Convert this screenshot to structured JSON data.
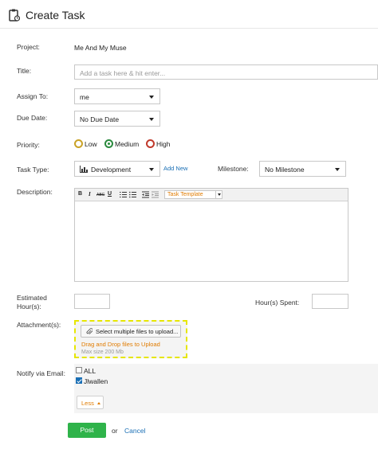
{
  "header": {
    "title": "Create Task",
    "icon": "task-clipboard-icon"
  },
  "project": {
    "label": "Project:",
    "value": "Me And My Muse"
  },
  "title_field": {
    "label": "Title:",
    "placeholder": "Add a task here & hit enter..."
  },
  "assign_to": {
    "label": "Assign To:",
    "value": "me"
  },
  "due_date": {
    "label": "Due Date:",
    "value": "No Due Date"
  },
  "priority": {
    "label": "Priority:",
    "options": [
      {
        "label": "Low",
        "color": "#c9a227",
        "selected": false
      },
      {
        "label": "Medium",
        "color": "#2b8a3e",
        "selected": true
      },
      {
        "label": "High",
        "color": "#c0392b",
        "selected": false
      }
    ]
  },
  "task_type": {
    "label": "Task Type:",
    "value": "Development",
    "add_new": "Add New"
  },
  "milestone": {
    "label": "Milestone:",
    "value": "No Milestone"
  },
  "description": {
    "label": "Description:",
    "toolbar": {
      "bold": "B",
      "italic": "I",
      "strike": "ABC",
      "underline": "U",
      "template": "Task Template"
    }
  },
  "estimated": {
    "label_line1": "Estimated",
    "label_line2": "Hour(s):"
  },
  "hours_spent": {
    "label": "Hour(s) Spent:"
  },
  "attachments": {
    "label": "Attachment(s):",
    "button": "Select multiple files to upload...",
    "drag_text": "Drag and Drop files to Upload",
    "max_size": "Max size 200 Mb"
  },
  "notify": {
    "label": "Notify via Email:",
    "options": [
      {
        "label": "ALL",
        "checked": false
      },
      {
        "label": "Jlwallen",
        "checked": true
      }
    ],
    "less": "Less"
  },
  "actions": {
    "post": "Post",
    "or": "or",
    "cancel": "Cancel"
  }
}
